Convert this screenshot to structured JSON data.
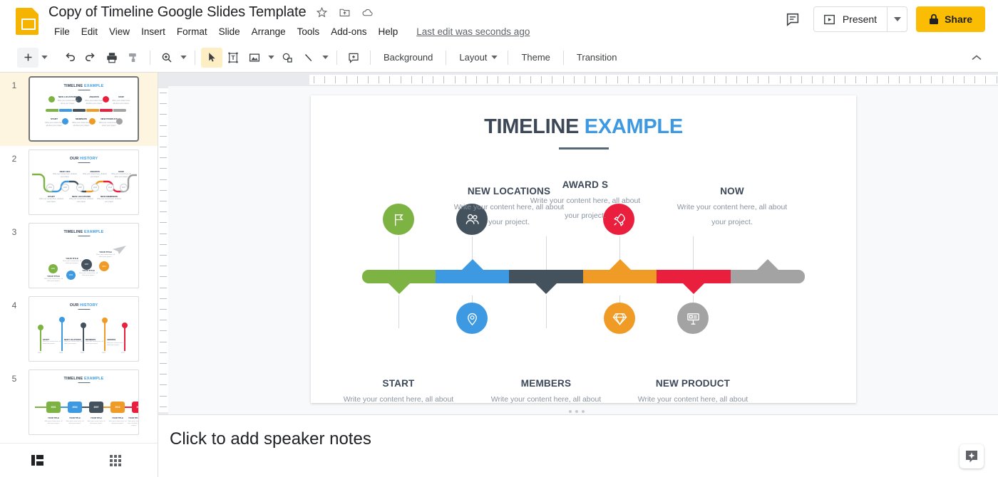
{
  "app": {
    "title": "Copy of Timeline Google Slides Template",
    "logo_icon": "google-slides-logo",
    "header_icons": [
      {
        "name": "star-icon",
        "label": "Star"
      },
      {
        "name": "move-to-folder-icon",
        "label": "Move to folder"
      },
      {
        "name": "cloud-status-icon",
        "label": "Document status"
      }
    ],
    "menus": [
      "File",
      "Edit",
      "View",
      "Insert",
      "Format",
      "Slide",
      "Arrange",
      "Tools",
      "Add-ons",
      "Help"
    ],
    "last_edit": "Last edit was seconds ago",
    "comment_icon": "comment-history-icon",
    "present_label": "Present",
    "present_icon": "present-play-icon",
    "present_caret_icon": "chevron-down-icon",
    "share_label": "Share",
    "share_lock_icon": "lock-icon",
    "share_color": "#FBBC04"
  },
  "toolbar": {
    "items": [
      {
        "name": "new-slide-button",
        "icon": "plus-icon",
        "label": ""
      },
      {
        "name": "new-slide-dropdown",
        "icon": "chevron-down-icon",
        "label": ""
      },
      {
        "name": "undo-button",
        "icon": "undo-icon",
        "label": ""
      },
      {
        "name": "redo-button",
        "icon": "redo-icon",
        "label": ""
      },
      {
        "name": "print-button",
        "icon": "print-icon",
        "label": ""
      },
      {
        "name": "paint-format-button",
        "icon": "paint-format-icon",
        "label": ""
      },
      {
        "name": "zoom-button",
        "icon": "zoom-in-icon",
        "label": ""
      },
      {
        "name": "zoom-dropdown",
        "icon": "chevron-down-icon",
        "label": ""
      },
      {
        "name": "select-tool-button",
        "icon": "cursor-arrow-icon",
        "label": ""
      },
      {
        "name": "text-box-button",
        "icon": "text-box-icon",
        "label": ""
      },
      {
        "name": "insert-image-button",
        "icon": "image-icon",
        "label": ""
      },
      {
        "name": "insert-image-dropdown",
        "icon": "chevron-down-icon",
        "label": ""
      },
      {
        "name": "shape-button",
        "icon": "shape-icon",
        "label": ""
      },
      {
        "name": "line-button",
        "icon": "line-icon",
        "label": ""
      },
      {
        "name": "line-dropdown",
        "icon": "chevron-down-icon",
        "label": ""
      },
      {
        "name": "add-comment-button",
        "icon": "add-comment-icon",
        "label": ""
      }
    ],
    "background_label": "Background",
    "layout_label": "Layout",
    "theme_label": "Theme",
    "transition_label": "Transition",
    "collapse_icon": "chevron-up-icon"
  },
  "filmstrip": {
    "slides": [
      {
        "number": "1",
        "title_dark": "TIMELINE ",
        "title_light": "EXAMPLE",
        "active": true
      },
      {
        "number": "2",
        "title_dark": "OUR ",
        "title_light": "HISTORY",
        "active": false
      },
      {
        "number": "3",
        "title_dark": "TIMELINE ",
        "title_light": "EXAMPLE",
        "active": false
      },
      {
        "number": "4",
        "title_dark": "OUR ",
        "title_light": "HISTORY",
        "active": false
      },
      {
        "number": "5",
        "title_dark": "TIMELINE ",
        "title_light": "EXAMPLE",
        "active": false
      }
    ],
    "footer": [
      {
        "name": "filmstrip-view-button",
        "icon": "filmstrip-view-icon"
      },
      {
        "name": "grid-view-button",
        "icon": "grid-view-icon"
      }
    ],
    "thumb2_circle_labels": [
      "2001",
      "2004",
      "2007",
      "2010",
      "2014",
      "2017"
    ],
    "thumb5_years": [
      "2001",
      "2004",
      "2007",
      "2012",
      "2017"
    ],
    "thumb_placeholder_heading": "YOUR TITLE",
    "thumb_placeholder_body": "Write your content here, all about your project.",
    "thumb4_years": [
      "2001",
      "2004",
      "2007",
      "2012",
      "2017"
    ]
  },
  "slide": {
    "title_dark": "TIMELINE ",
    "title_light": "EXAMPLE",
    "body_text": "Write your content here, all about your project.",
    "colors": {
      "green": "#7cb342",
      "blue": "#3d9ae2",
      "slate": "#44525e",
      "orange": "#ef9b26",
      "red": "#ea1f3d",
      "gray": "#a3a3a3",
      "title_dark": "#3c4858",
      "title_accent": "#3d9ae2"
    },
    "segments": [
      {
        "name": "segment-green",
        "color": "#7cb342",
        "direction": "down"
      },
      {
        "name": "segment-blue",
        "color": "#3d9ae2",
        "direction": "up"
      },
      {
        "name": "segment-slate",
        "color": "#44525e",
        "direction": "down"
      },
      {
        "name": "segment-orange",
        "color": "#ef9b26",
        "direction": "up"
      },
      {
        "name": "segment-red",
        "color": "#ea1f3d",
        "direction": "down"
      },
      {
        "name": "segment-gray",
        "color": "#a3a3a3",
        "direction": "up"
      }
    ],
    "top_items": [
      {
        "icon": "flag-icon",
        "icon_color": "#7cb342",
        "heading": "",
        "body": ""
      },
      {
        "icon": "",
        "icon_color": "",
        "heading": "NEW LOCATIONS",
        "body": "Write your content here, all about your project."
      },
      {
        "icon": "people-icon",
        "icon_color": "#44525e",
        "heading": "",
        "body": ""
      },
      {
        "icon": "",
        "icon_color": "",
        "heading": "AWARD S",
        "body": "Write your content here, all about your project."
      },
      {
        "icon": "rocket-icon",
        "icon_color": "#ea1f3d",
        "heading": "",
        "body": ""
      },
      {
        "icon": "",
        "icon_color": "",
        "heading": "NOW",
        "body": "Write your content here, all about your project."
      }
    ],
    "bottom_items": [
      {
        "icon": "",
        "icon_color": "",
        "heading": "START",
        "body": "Write your content here, all about your project."
      },
      {
        "icon": "location-pin-icon",
        "icon_color": "#3d9ae2",
        "heading": "",
        "body": ""
      },
      {
        "icon": "",
        "icon_color": "",
        "heading": "MEMBERS",
        "body": "Write your content here, all about your project."
      },
      {
        "icon": "diamond-icon",
        "icon_color": "#ef9b26",
        "heading": "",
        "body": ""
      },
      {
        "icon": "",
        "icon_color": "",
        "heading": "NEW PRODUCT",
        "body": "Write your content here, all about your project."
      },
      {
        "icon": "billboard-icon",
        "icon_color": "#a3a3a3",
        "heading": "",
        "body": ""
      }
    ],
    "headings": {
      "new_locations": "NEW LOCATIONS",
      "awards": "AWARD S",
      "now": "NOW",
      "start": "START",
      "members": "MEMBERS",
      "new_product": "NEW PRODUCT"
    }
  },
  "notes": {
    "placeholder": "Click to add speaker notes",
    "explore_icon": "explore-icon"
  }
}
